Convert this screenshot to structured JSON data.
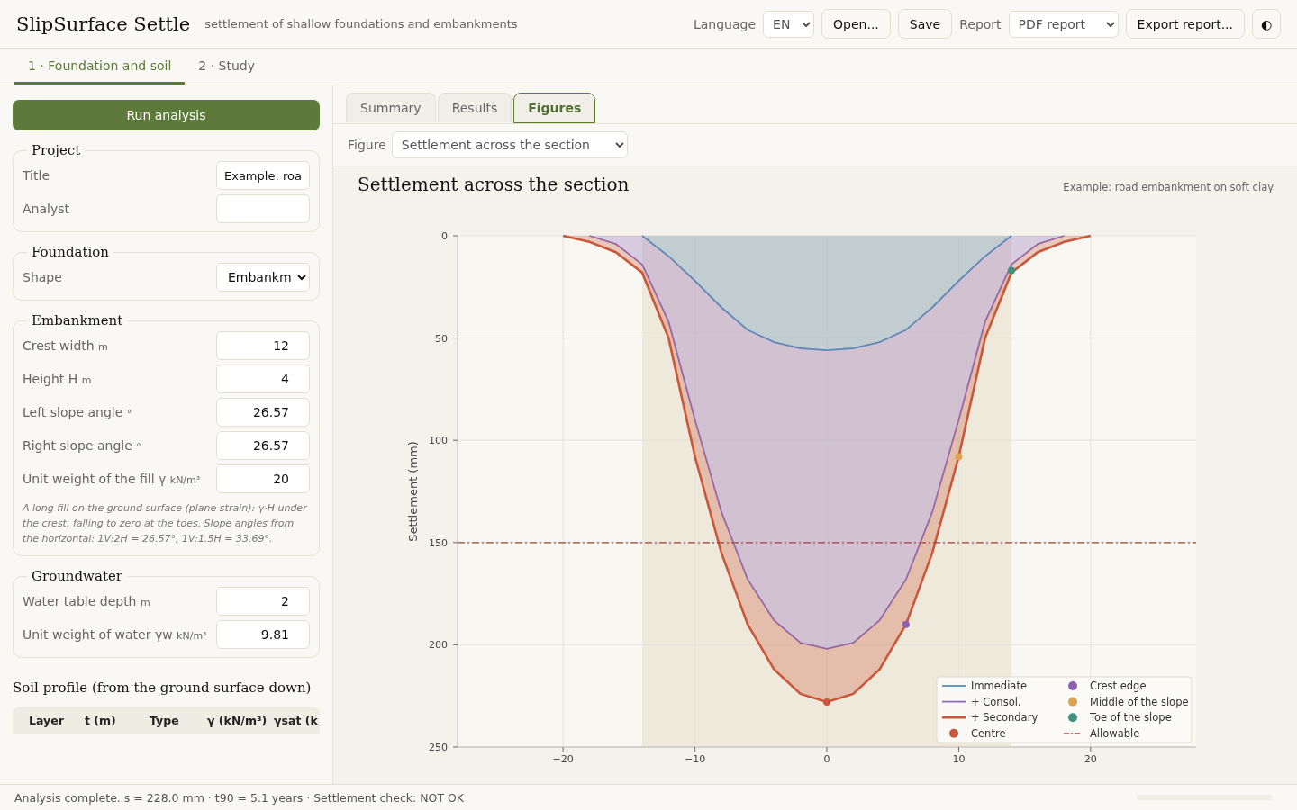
{
  "app": {
    "title": "SlipSurface Settle",
    "subtitle": "settlement of shallow foundations and embankments"
  },
  "toolbar": {
    "language_label": "Language",
    "language": "EN",
    "open_button": "Open...",
    "save_button": "Save",
    "report_label": "Report",
    "report": "PDF report",
    "export_button": "Export report...",
    "theme_button": "◐"
  },
  "steps": [
    {
      "label": "1 · Foundation and soil",
      "selected": true
    },
    {
      "label": "2 · Study",
      "selected": false
    }
  ],
  "sidebar": {
    "run_button": "Run analysis",
    "groups": [
      {
        "title": "Project",
        "fields": [
          {
            "kind": "text",
            "label": "Title",
            "value": "Example: roa"
          },
          {
            "kind": "text",
            "label": "Analyst"
          }
        ]
      },
      {
        "title": "Foundation",
        "fields": [
          {
            "kind": "select",
            "label": "Shape",
            "value": "Embankm"
          }
        ]
      },
      {
        "title": "Embankment",
        "fields": [
          {
            "kind": "number",
            "label": "Crest width",
            "unit": "m",
            "value": "12"
          },
          {
            "kind": "number",
            "label": "Height H",
            "unit": "m",
            "value": "4"
          },
          {
            "kind": "number",
            "label": "Left slope angle",
            "unit": "°",
            "value": "26.57"
          },
          {
            "kind": "number",
            "label": "Right slope angle",
            "unit": "°",
            "value": "26.57"
          },
          {
            "kind": "number",
            "label": "Unit weight of the fill γ",
            "unit": "kN/m³",
            "value": "20"
          }
        ],
        "note": "A long fill on the ground surface (plane strain): γ·H under the crest, falling to zero at the toes. Slope angles from the horizontal: 1V:2H = 26.57°, 1V:1.5H = 33.69°."
      },
      {
        "title": "Groundwater",
        "fields": [
          {
            "kind": "number",
            "label": "Water table depth",
            "unit": "m",
            "value": "2"
          },
          {
            "kind": "number",
            "label": "Unit weight of water γw",
            "unit": "kN/m³",
            "value": "9.81"
          }
        ]
      }
    ],
    "soil_profile": {
      "title": "Soil profile (from the ground surface down)",
      "columns": [
        "Layer",
        "t (m)",
        "Type",
        "γ (kN/m³)",
        "γsat (k"
      ]
    }
  },
  "results": {
    "tabs": [
      {
        "label": "Summary",
        "selected": false
      },
      {
        "label": "Results",
        "selected": false
      },
      {
        "label": "Figures",
        "selected": true
      }
    ],
    "figure_label": "Figure",
    "figure": "Settlement across the section",
    "subtitle": "Example: road embankment on soft clay",
    "chart_data": {
      "type": "area",
      "title": "Settlement across the section",
      "ylabel": "Settlement (mm)",
      "x": [
        -20,
        -18,
        -16,
        -14,
        -12,
        -10,
        -8,
        -6,
        -4,
        -2,
        0,
        2,
        4,
        6,
        8,
        10,
        12,
        14,
        16,
        18,
        20
      ],
      "series": [
        {
          "name": "Immediate",
          "color": "#5b8db8",
          "values": [
            null,
            null,
            null,
            0,
            10,
            22,
            35,
            46,
            52,
            55,
            56,
            55,
            52,
            46,
            35,
            22,
            10,
            0,
            null,
            null,
            null
          ]
        },
        {
          "name": "+ Consol.",
          "color": "#8e6bb8",
          "values": [
            null,
            0,
            4,
            14,
            42,
            90,
            135,
            168,
            188,
            199,
            202,
            199,
            188,
            168,
            135,
            90,
            42,
            14,
            4,
            0,
            null
          ]
        },
        {
          "name": "+ Secondary",
          "color": "#c9583a",
          "values": [
            0,
            3,
            8,
            18,
            50,
            108,
            155,
            190,
            212,
            224,
            228,
            224,
            212,
            190,
            155,
            108,
            50,
            18,
            8,
            3,
            0
          ]
        },
        {
          "name": "Centre",
          "type": "scatter",
          "color": "#c9583a",
          "values": [
            null,
            null,
            null,
            null,
            null,
            null,
            null,
            null,
            null,
            null,
            228,
            null,
            null,
            null,
            null,
            null,
            null,
            null,
            null,
            null,
            null
          ]
        },
        {
          "name": "Crest edge",
          "type": "scatter",
          "color": "#8e5fb0",
          "values": [
            null,
            null,
            null,
            null,
            null,
            null,
            null,
            null,
            null,
            null,
            null,
            null,
            null,
            190,
            null,
            null,
            null,
            null,
            null,
            null,
            null
          ]
        },
        {
          "name": "Middle of the slope",
          "type": "scatter",
          "color": "#dba24f",
          "values": [
            null,
            null,
            null,
            null,
            null,
            null,
            null,
            null,
            null,
            null,
            null,
            null,
            null,
            null,
            null,
            108,
            null,
            null,
            null,
            null,
            null
          ]
        },
        {
          "name": "Toe of the slope",
          "type": "scatter",
          "color": "#3f9480",
          "values": [
            null,
            null,
            null,
            null,
            null,
            null,
            null,
            null,
            null,
            null,
            null,
            null,
            null,
            null,
            null,
            null,
            null,
            17,
            null,
            null,
            null
          ]
        }
      ],
      "xlim": [
        -28,
        28
      ],
      "ylim": [
        250,
        0
      ],
      "xticks": [
        {
          "value": -20,
          "label": "−20"
        },
        {
          "value": -10,
          "label": "−10"
        },
        0,
        10,
        20
      ],
      "yticks": [
        0,
        50,
        100,
        150,
        200,
        250
      ],
      "grid": true,
      "legend": true,
      "ref_lines": [
        {
          "axis": "y",
          "value": 150,
          "label": "Allowable",
          "color": "#a8413a"
        }
      ],
      "bands": [
        {
          "axis": "x",
          "from": -14,
          "to": 14,
          "color": "#efe9dc"
        }
      ]
    }
  },
  "status_bar": {
    "message": "Analysis complete. s = 228.0 mm · t90 = 5.1 years · Settlement check: NOT OK"
  }
}
